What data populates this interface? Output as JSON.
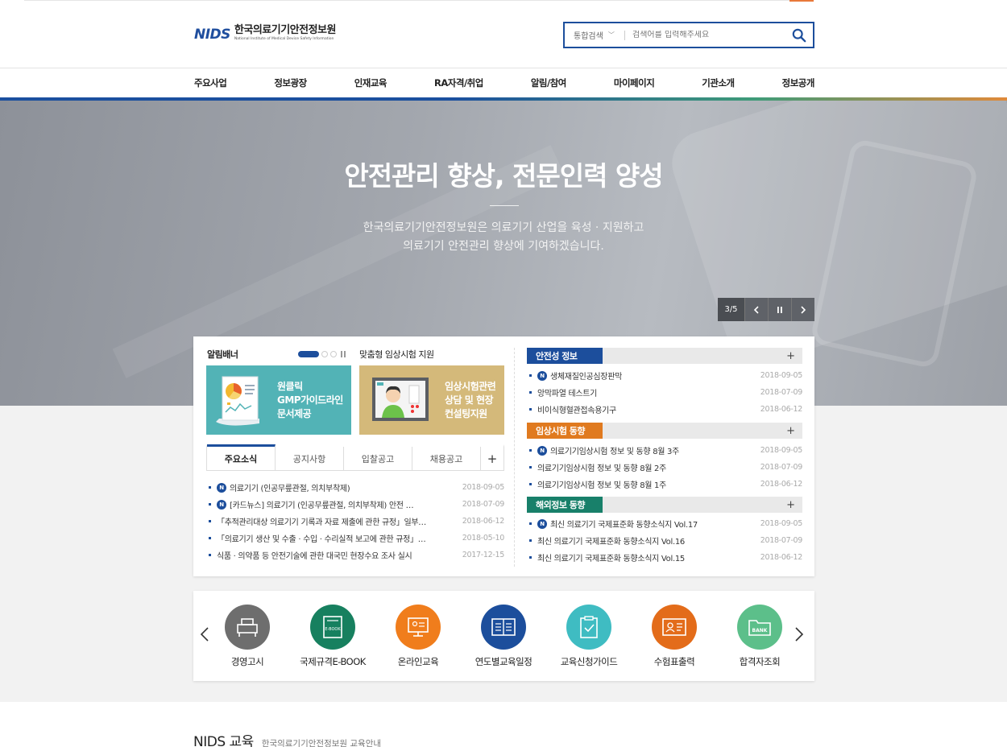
{
  "logo": {
    "mark": "NIDS",
    "name_ko": "한국의료기기안전정보원",
    "name_en": "National Institute of Medical Device Safety Information"
  },
  "search": {
    "category": "통합검색",
    "placeholder": "검색어를 입력해주세요"
  },
  "gnb": [
    "주요사업",
    "정보광장",
    "인재교육",
    "RA자격/취업",
    "알림/참여",
    "마이페이지",
    "기관소개",
    "정보공개"
  ],
  "hero": {
    "title": "안전관리 향상, 전문인력 양성",
    "subtitle_line1": "한국의료기기안전정보원은 의료기기 산업을 육성 · 지원하고",
    "subtitle_line2": "의료기기 안전관리 향상에 기여하겠습니다.",
    "counter": "3/5"
  },
  "notice_banner": {
    "label": "알림배너",
    "clinical_label": "맞춤형 임상시험 지원",
    "banner1": [
      "원클릭",
      "GMP가이드라인",
      "문서제공"
    ],
    "banner2": [
      "임상시험관련",
      "상담 및 현장",
      "컨설팅지원"
    ]
  },
  "tabs": [
    "주요소식",
    "공지사항",
    "입찰공고",
    "채용공고"
  ],
  "news": [
    {
      "title": "의료기기 (인공무릎관절, 의치부착제)",
      "date": "2018-09-05",
      "new": true
    },
    {
      "title": "[카드뉴스] 의료기기 (인공무릎관절, 의치부착제) 안전 …",
      "date": "2018-07-09",
      "new": true
    },
    {
      "title": "「추적관리대상 의료기기 기록과 자료 제출에 관한 규정」일부…",
      "date": "2018-06-12",
      "new": false
    },
    {
      "title": "「의료기기 생산 및 수출 · 수입 · 수리실적 보고에 관한 규정」…",
      "date": "2018-05-10",
      "new": false
    },
    {
      "title": "식품 · 의약품 등 안전기술에 관한 대국민 현장수요 조사 실시",
      "date": "2017-12-15",
      "new": false
    }
  ],
  "info": [
    {
      "title": "안전성 정보",
      "color": "#1c4e9c",
      "items": [
        {
          "title": "생체재질인공심장판막",
          "date": "2018-09-05",
          "new": true
        },
        {
          "title": "앙막파열 테스트기",
          "date": "2018-07-09",
          "new": false
        },
        {
          "title": "비이식형혈관접속용기구",
          "date": "2018-06-12",
          "new": false
        }
      ]
    },
    {
      "title": "임상시험 동향",
      "color": "#e07a1f",
      "items": [
        {
          "title": "의료기기임상시험 정보 및 동향 8월 3주",
          "date": "2018-09-05",
          "new": true
        },
        {
          "title": "의료기기임상시험 정보 및 동향 8월 2주",
          "date": "2018-07-09",
          "new": false
        },
        {
          "title": "의료기기임상시험 정보 및 동향 8월 1주",
          "date": "2018-06-12",
          "new": false
        }
      ]
    },
    {
      "title": "해외정보 동향",
      "color": "#18806a",
      "items": [
        {
          "title": "최신 의료기기 국제표준화 동향소식지 Vol.17",
          "date": "2018-09-05",
          "new": true
        },
        {
          "title": "최신 의료기기 국제표준화 동향소식지 Vol.16",
          "date": "2018-07-09",
          "new": false
        },
        {
          "title": "최신 의료기기 국제표준화 동향소식지 Vol.15",
          "date": "2018-06-12",
          "new": false
        }
      ]
    }
  ],
  "quick": [
    {
      "label": "경영고시",
      "icon": "desk-icon",
      "color": "#6e6e6e"
    },
    {
      "label": "국제규격E-BOOK",
      "icon": "ebook-icon",
      "color": "#17805f"
    },
    {
      "label": "온라인교육",
      "icon": "monitor-icon",
      "color": "#f07d1c"
    },
    {
      "label": "연도별교육일정",
      "icon": "calendar-icon",
      "color": "#1c4e9c"
    },
    {
      "label": "교육신청가이드",
      "icon": "checklist-icon",
      "color": "#3fbcc2"
    },
    {
      "label": "수험표출력",
      "icon": "id-card-icon",
      "color": "#e36c1a"
    },
    {
      "label": "합격자조회",
      "icon": "bank-folder-icon",
      "color": "#5cbf8a"
    }
  ],
  "education": {
    "title": "NIDS 교육",
    "subtitle": "한국의료기기안전정보원 교육안내"
  }
}
